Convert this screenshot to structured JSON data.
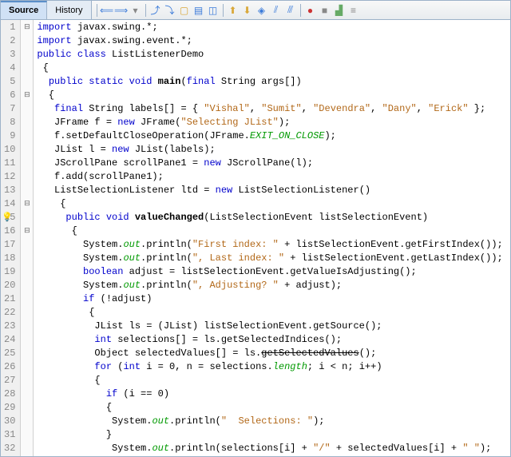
{
  "tabs": {
    "source": "Source",
    "history": "History"
  },
  "lines": [
    {
      "n": "1",
      "fold": "⊟",
      "code": [
        {
          "c": "kw",
          "t": "import"
        },
        {
          "t": " javax.swing.*;"
        }
      ]
    },
    {
      "n": "2",
      "fold": "",
      "code": [
        {
          "c": "kw",
          "t": "import"
        },
        {
          "t": " javax.swing.event.*;"
        }
      ]
    },
    {
      "n": "3",
      "fold": "",
      "code": [
        {
          "c": "kw",
          "t": "public class"
        },
        {
          "t": " ListListenerDemo"
        }
      ]
    },
    {
      "n": "4",
      "fold": "",
      "code": [
        {
          "t": " {"
        }
      ]
    },
    {
      "n": "5",
      "fold": "",
      "code": [
        {
          "t": "  "
        },
        {
          "c": "kw",
          "t": "public static void"
        },
        {
          "t": " "
        },
        {
          "c": "meth",
          "t": "main"
        },
        {
          "t": "("
        },
        {
          "c": "kw",
          "t": "final"
        },
        {
          "t": " String args[])"
        }
      ]
    },
    {
      "n": "6",
      "fold": "⊟",
      "code": [
        {
          "t": "  {"
        }
      ]
    },
    {
      "n": "7",
      "fold": "",
      "code": [
        {
          "t": "   "
        },
        {
          "c": "kw",
          "t": "final"
        },
        {
          "t": " String labels[] = { "
        },
        {
          "c": "str",
          "t": "\"Vishal\""
        },
        {
          "t": ", "
        },
        {
          "c": "str",
          "t": "\"Sumit\""
        },
        {
          "t": ", "
        },
        {
          "c": "str",
          "t": "\"Devendra\""
        },
        {
          "t": ", "
        },
        {
          "c": "str",
          "t": "\"Dany\""
        },
        {
          "t": ", "
        },
        {
          "c": "str",
          "t": "\"Erick\""
        },
        {
          "t": " };"
        }
      ]
    },
    {
      "n": "8",
      "fold": "",
      "code": [
        {
          "t": "   JFrame f = "
        },
        {
          "c": "kw",
          "t": "new"
        },
        {
          "t": " JFrame("
        },
        {
          "c": "str",
          "t": "\"Selecting JList\""
        },
        {
          "t": ");"
        }
      ]
    },
    {
      "n": "9",
      "fold": "",
      "code": [
        {
          "t": "   f.setDefaultCloseOperation(JFrame."
        },
        {
          "c": "stat",
          "t": "EXIT_ON_CLOSE"
        },
        {
          "t": ");"
        }
      ]
    },
    {
      "n": "10",
      "fold": "",
      "code": [
        {
          "t": "   JList l = "
        },
        {
          "c": "kw",
          "t": "new"
        },
        {
          "t": " JList(labels);"
        }
      ]
    },
    {
      "n": "11",
      "fold": "",
      "code": [
        {
          "t": "   JScrollPane scrollPane1 = "
        },
        {
          "c": "kw",
          "t": "new"
        },
        {
          "t": " JScrollPane(l);"
        }
      ]
    },
    {
      "n": "12",
      "fold": "",
      "code": [
        {
          "t": "   f.add(scrollPane1);"
        }
      ]
    },
    {
      "n": "13",
      "fold": "",
      "code": [
        {
          "t": "   ListSelectionListener ltd = "
        },
        {
          "c": "kw",
          "t": "new"
        },
        {
          "t": " ListSelectionListener()"
        }
      ]
    },
    {
      "n": "14",
      "fold": "⊟",
      "code": [
        {
          "t": "    {"
        }
      ]
    },
    {
      "n": "15",
      "fold": "",
      "bulb": true,
      "code": [
        {
          "t": "     "
        },
        {
          "c": "kw",
          "t": "public void"
        },
        {
          "t": " "
        },
        {
          "c": "meth",
          "t": "valueChanged"
        },
        {
          "t": "(ListSelectionEvent listSelectionEvent)"
        }
      ]
    },
    {
      "n": "16",
      "fold": "⊟",
      "code": [
        {
          "t": "      {"
        }
      ]
    },
    {
      "n": "17",
      "fold": "",
      "code": [
        {
          "t": "        System."
        },
        {
          "c": "stat",
          "t": "out"
        },
        {
          "t": ".println("
        },
        {
          "c": "str",
          "t": "\"First index: \""
        },
        {
          "t": " + listSelectionEvent.getFirstIndex());"
        }
      ]
    },
    {
      "n": "18",
      "fold": "",
      "code": [
        {
          "t": "        System."
        },
        {
          "c": "stat",
          "t": "out"
        },
        {
          "t": ".println("
        },
        {
          "c": "str",
          "t": "\", Last index: \""
        },
        {
          "t": " + listSelectionEvent.getLastIndex());"
        }
      ]
    },
    {
      "n": "19",
      "fold": "",
      "code": [
        {
          "t": "        "
        },
        {
          "c": "kw",
          "t": "boolean"
        },
        {
          "t": " adjust = listSelectionEvent.getValueIsAdjusting();"
        }
      ]
    },
    {
      "n": "20",
      "fold": "",
      "code": [
        {
          "t": "        System."
        },
        {
          "c": "stat",
          "t": "out"
        },
        {
          "t": ".println("
        },
        {
          "c": "str",
          "t": "\", Adjusting? \""
        },
        {
          "t": " + adjust);"
        }
      ]
    },
    {
      "n": "21",
      "fold": "",
      "code": [
        {
          "t": "        "
        },
        {
          "c": "kw",
          "t": "if"
        },
        {
          "t": " (!adjust)"
        }
      ]
    },
    {
      "n": "22",
      "fold": "",
      "code": [
        {
          "t": "         {"
        }
      ]
    },
    {
      "n": "23",
      "fold": "",
      "code": [
        {
          "t": "          JList ls = (JList) listSelectionEvent.getSource();"
        }
      ]
    },
    {
      "n": "24",
      "fold": "",
      "code": [
        {
          "t": "          "
        },
        {
          "c": "kw",
          "t": "int"
        },
        {
          "t": " selections[] = ls.getSelectedIndices();"
        }
      ]
    },
    {
      "n": "25",
      "fold": "",
      "code": [
        {
          "t": "          Object selectedValues[] = ls."
        },
        {
          "c": "strike",
          "t": "getSelectedValues"
        },
        {
          "t": "();"
        }
      ]
    },
    {
      "n": "26",
      "fold": "",
      "code": [
        {
          "t": "          "
        },
        {
          "c": "kw",
          "t": "for"
        },
        {
          "t": " ("
        },
        {
          "c": "kw",
          "t": "int"
        },
        {
          "t": " i = 0, n = selections."
        },
        {
          "c": "stat",
          "t": "length"
        },
        {
          "t": "; i < n; i++)"
        }
      ]
    },
    {
      "n": "27",
      "fold": "",
      "code": [
        {
          "t": "          {"
        }
      ]
    },
    {
      "n": "28",
      "fold": "",
      "code": [
        {
          "t": "            "
        },
        {
          "c": "kw",
          "t": "if"
        },
        {
          "t": " (i == 0)"
        }
      ]
    },
    {
      "n": "29",
      "fold": "",
      "code": [
        {
          "t": "            {"
        }
      ]
    },
    {
      "n": "30",
      "fold": "",
      "code": [
        {
          "t": "             System."
        },
        {
          "c": "stat",
          "t": "out"
        },
        {
          "t": ".println("
        },
        {
          "c": "str",
          "t": "\"  Selections: \""
        },
        {
          "t": ");"
        }
      ]
    },
    {
      "n": "31",
      "fold": "",
      "code": [
        {
          "t": "            }"
        }
      ]
    },
    {
      "n": "32",
      "fold": "",
      "code": [
        {
          "t": "             System."
        },
        {
          "c": "stat",
          "t": "out"
        },
        {
          "t": ".println(selections[i] + "
        },
        {
          "c": "str",
          "t": "\"/\""
        },
        {
          "t": " + selectedValues[i] + "
        },
        {
          "c": "str",
          "t": "\" \""
        },
        {
          "t": ");"
        }
      ]
    }
  ]
}
